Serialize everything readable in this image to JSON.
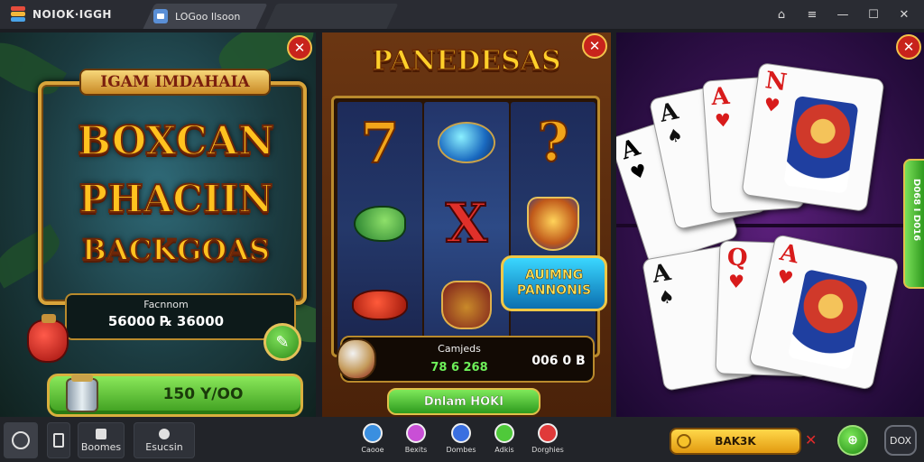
{
  "window": {
    "brand": "NOIOK·IGGH",
    "tab_title": "LOGoo Ilsoon",
    "controls": [
      "⌂",
      "≡",
      "—",
      "☐",
      "✕"
    ]
  },
  "panel_left": {
    "badge_title": "IGAM IMDAHAIA",
    "title_line1": "BOXCAN",
    "title_line2": "PHACIIN",
    "title_line3": "BACKGOAS",
    "score_label": "Facnnom",
    "score_value": "56000 ℞ 36000",
    "action_label": "150 Y/OO",
    "close": "✕",
    "edit": "✎"
  },
  "panel_middle": {
    "title": "PANEDESAS",
    "badge_line1": "AUIMNG",
    "badge_line2": "PANNONIS",
    "info_label": "Camjeds",
    "info_green": "78 6 268",
    "info_right": "006 0 B",
    "spin_label": "Dnlam HOKI",
    "close": "✕",
    "symbols": {
      "seven": "7",
      "x": "X",
      "q": "?"
    }
  },
  "panel_right": {
    "close": "✕",
    "side_tab": "D068 I D016",
    "cards_top": [
      {
        "rank": "A",
        "suit": "♥",
        "color": "red"
      },
      {
        "rank": "A",
        "suit": "♠",
        "color": "black"
      },
      {
        "rank": "A",
        "suit": "♥",
        "color": "red"
      },
      {
        "rank": "N",
        "suit": "♥",
        "color": "red"
      }
    ],
    "cards_bottom": [
      {
        "rank": "A",
        "suit": "♠",
        "color": "black"
      },
      {
        "rank": "Q",
        "suit": "♥",
        "color": "red"
      },
      {
        "rank": "A",
        "suit": "♥",
        "color": "red"
      }
    ]
  },
  "bottom_bar": {
    "game_label": "Boomes",
    "user_label": "Esucsin",
    "quick_items": [
      {
        "label": "Caooe",
        "color": "#3a8fe0"
      },
      {
        "label": "Bexits",
        "color": "#c94fd6"
      },
      {
        "label": "Dombes",
        "color": "#3a6fe0"
      },
      {
        "label": "Adkis",
        "color": "#4fc93a"
      },
      {
        "label": "Dorghies",
        "color": "#e03a3a"
      }
    ],
    "gold_label": "BAK3K",
    "x_mark": "✕",
    "go_label": "⊕",
    "close_label": "DOX"
  }
}
